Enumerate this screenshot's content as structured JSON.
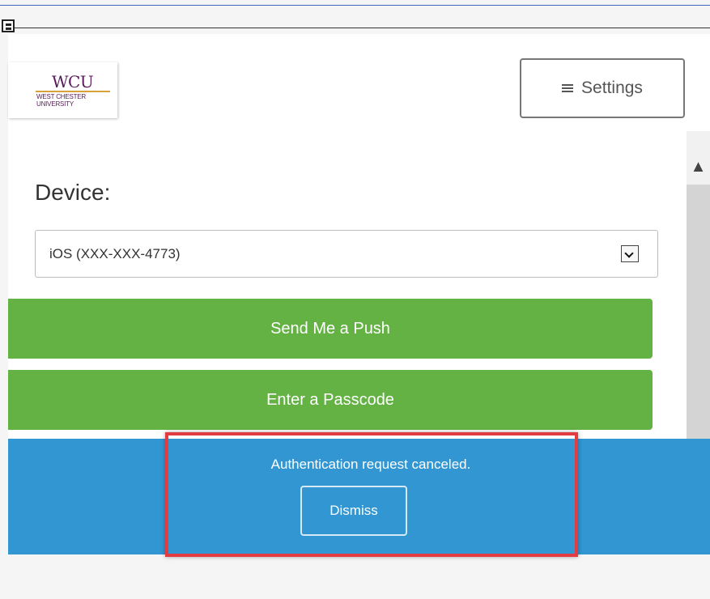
{
  "logo": {
    "title": "WCU",
    "subtitle_1": "WEST CHESTER",
    "subtitle_2": "UNIVERSITY"
  },
  "header": {
    "settings_label": "Settings",
    "settings_icon": "menu-icon"
  },
  "device": {
    "label": "Device:",
    "selected": "iOS (XXX-XXX-4773)",
    "dropdown_icon": "chevron-down-icon"
  },
  "actions": {
    "push_label": "Send Me a Push",
    "passcode_label": "Enter a Passcode"
  },
  "notification": {
    "message": "Authentication request canceled.",
    "dismiss_label": "Dismiss"
  },
  "colors": {
    "accent_green": "#64b244",
    "notice_blue": "#3196d2",
    "highlight_red": "#e23b42"
  }
}
